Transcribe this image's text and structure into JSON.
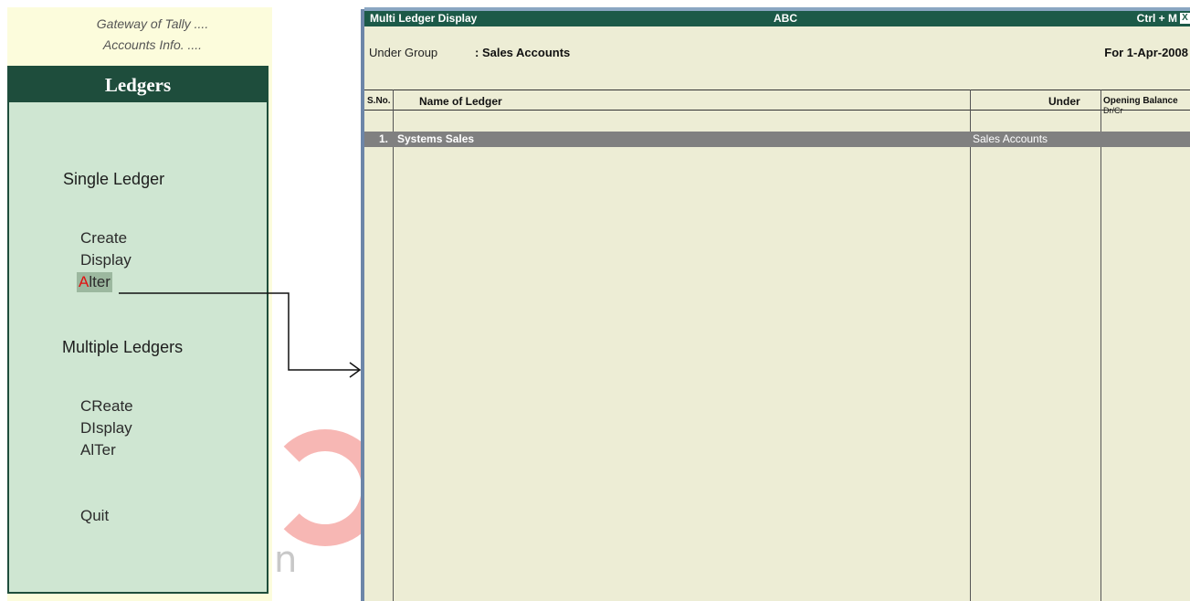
{
  "left_panel": {
    "breadcrumb_1": "Gateway of Tally ....",
    "breadcrumb_2": "Accounts Info. ....",
    "menu_title": "Ledgers",
    "section_single": "Single Ledger",
    "single_items": [
      {
        "hotkey": "",
        "rest": "Create"
      },
      {
        "hotkey": "",
        "rest": "Display"
      },
      {
        "hotkey": "A",
        "rest": "lter"
      }
    ],
    "section_multiple": "Multiple Ledgers",
    "multiple_items": [
      "CReate",
      "DIsplay",
      "AlTer"
    ],
    "quit": "Quit"
  },
  "window": {
    "title_left": "Multi Ledger  Display",
    "title_center": "ABC",
    "title_right": "Ctrl + M",
    "close_glyph": "X",
    "under_group_label": "Under Group",
    "under_group_value": ": Sales Accounts",
    "period": "For 1-Apr-2008",
    "columns": {
      "sno": "S.No.",
      "name": "Name of Ledger",
      "under": "Under",
      "opening": "Opening Balance",
      "drcr": "Dr/Cr"
    },
    "rows": [
      {
        "sno": "1.",
        "name": "Systems Sales",
        "under": "Sales Accounts"
      }
    ]
  },
  "watermark": "n",
  "colors": {
    "menu_bg": "#cfe6d2",
    "header_green": "#1e4d3c",
    "title_bar": "#1c5a48",
    "window_bg": "#ededd5",
    "selected_row": "#808080",
    "hotkey_red": "#e21010"
  }
}
